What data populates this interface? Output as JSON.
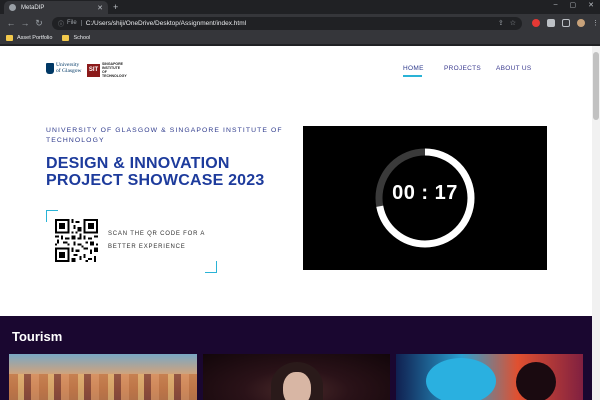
{
  "browser": {
    "tab_title": "MetaDIP",
    "tab_close": "✕",
    "new_tab": "+",
    "window_controls": [
      "–",
      "▢",
      "✕"
    ],
    "nav": {
      "back": "←",
      "forward": "→",
      "reload": "↻"
    },
    "address": {
      "scheme_label": "File",
      "url": "C:/Users/shiji/OneDrive/Desktop/Assignment/index.html"
    },
    "bookmarks": [
      {
        "label": "Asset Portfolio",
        "icon": "folder-icon"
      },
      {
        "label": "School",
        "icon": "folder-icon"
      }
    ]
  },
  "site": {
    "logos": {
      "uog": "University of Glasgow",
      "sit_mark": "SIT",
      "sit_text": "SINGAPORE INSTITUTE OF TECHNOLOGY"
    },
    "nav": [
      {
        "label": "HOME",
        "active": true
      },
      {
        "label": "PROJECTS",
        "active": false
      },
      {
        "label": "ABOUT US",
        "active": false
      }
    ],
    "eyebrow": "UNIVERSITY OF GLASGOW & SINGAPORE INSTITUTE OF TECHNOLOGY",
    "headline": "DESIGN & INNOVATION PROJECT SHOWCASE 2023",
    "qr_caption": "SCAN THE QR CODE FOR A BETTER EXPERIENCE",
    "countdown": {
      "display": "00 : 17",
      "progress_fraction": 0.72
    },
    "tourism": {
      "title": "Tourism"
    }
  },
  "colors": {
    "accent": "#2ab3d6",
    "headline": "#1d3b9c",
    "nav_text": "#3b3b8f",
    "tourism_bg": "#1a0730"
  }
}
